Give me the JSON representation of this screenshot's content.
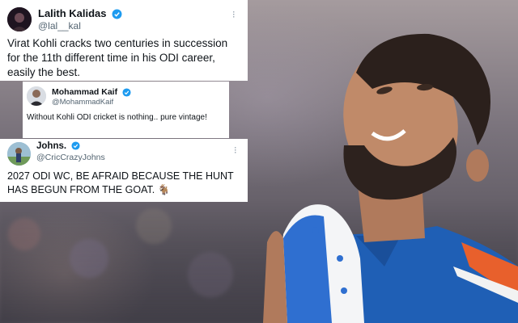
{
  "tweets": [
    {
      "name": "Lalith Kalidas",
      "handle": "@lal__kal",
      "verified": true,
      "text": "Virat Kohli cracks two centuries in succession for the 11th different time in his ODI career, easily the best."
    },
    {
      "name": "Mohammad Kaif",
      "handle": "@MohammadKaif",
      "verified": true,
      "text": "Without Kohli ODI cricket is nothing.. pure vintage!"
    },
    {
      "name": "Johns.",
      "handle": "@CricCrazyJohns",
      "verified": true,
      "text": "2027 ODI WC, BE AFRAID BECAUSE THE HUNT HAS BEGUN FROM THE GOAT. 🐐"
    }
  ],
  "icons": {
    "verified": "verified-badge-icon",
    "more": "more-options-icon"
  },
  "colors": {
    "verified_blue": "#1d9bf0",
    "handle_gray": "#536471",
    "jersey_blue": "#1f5fb5",
    "jersey_orange": "#e8602c"
  }
}
